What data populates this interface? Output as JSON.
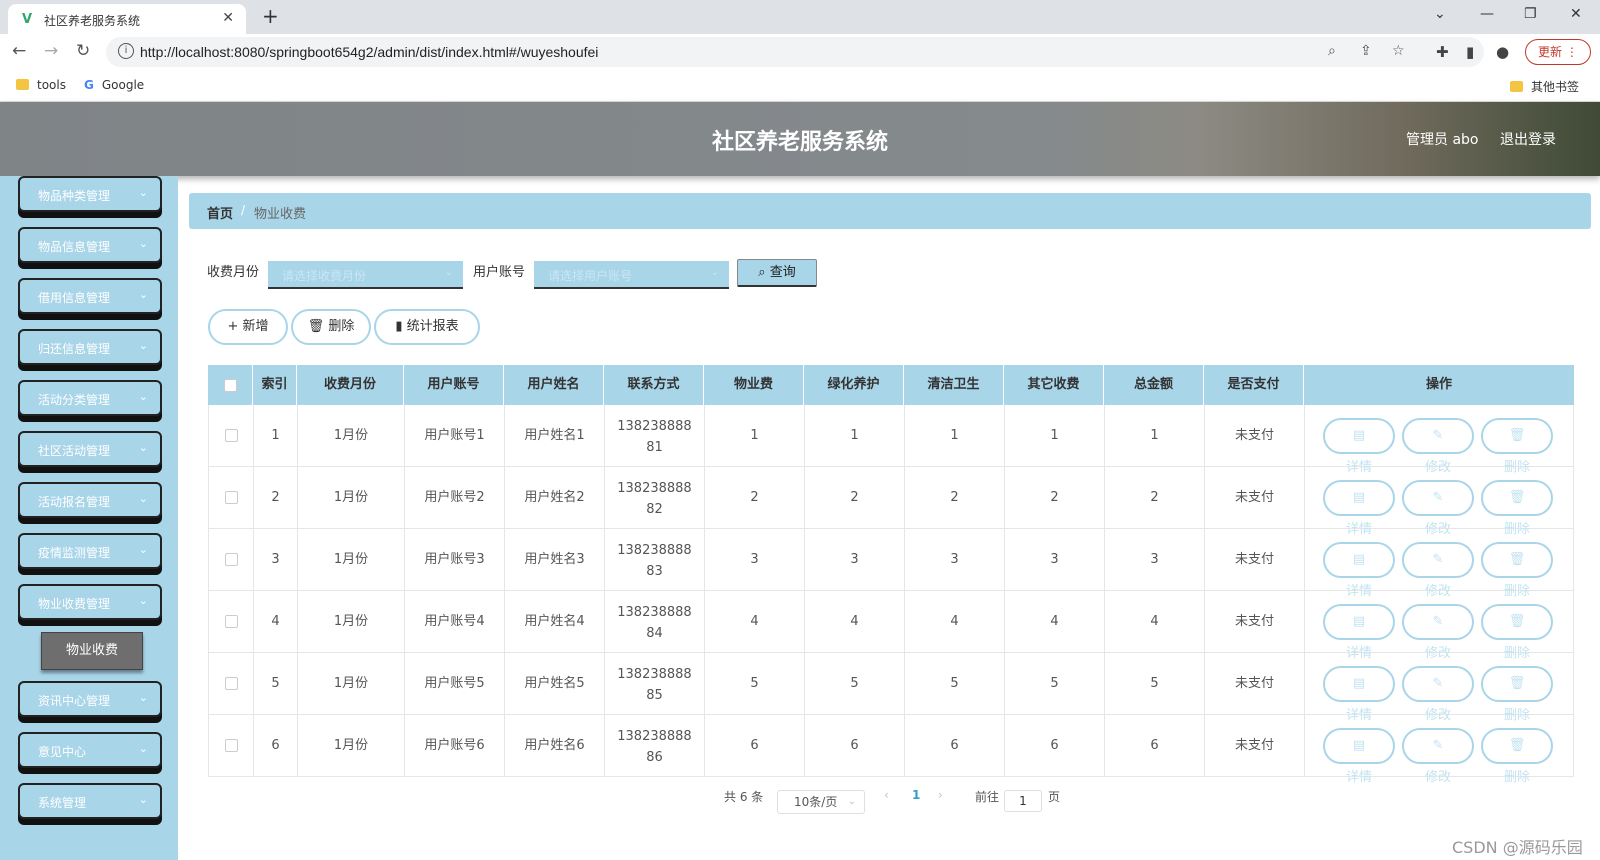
{
  "browser": {
    "tab_title": "社区养老服务系统",
    "url": "http://localhost:8080/springboot654g2/admin/dist/index.html#/wuyeshoufei",
    "update_label": "更新",
    "bookmarks": [
      "tools",
      "Google"
    ],
    "other_bookmarks": "其他书签"
  },
  "header": {
    "title": "社区养老服务系统",
    "admin": "管理员 abo",
    "logout": "退出登录"
  },
  "sidebar": {
    "items": [
      {
        "label": "物品种类管理"
      },
      {
        "label": "物品信息管理"
      },
      {
        "label": "借用信息管理"
      },
      {
        "label": "归还信息管理"
      },
      {
        "label": "活动分类管理"
      },
      {
        "label": "社区活动管理"
      },
      {
        "label": "活动报名管理"
      },
      {
        "label": "疫情监测管理"
      },
      {
        "label": "物业收费管理"
      },
      {
        "label": "资讯中心管理"
      },
      {
        "label": "意见中心"
      },
      {
        "label": "系统管理"
      }
    ],
    "active_sub": "物业收费"
  },
  "breadcrumb": {
    "home": "首页",
    "separator": "/",
    "current": "物业收费"
  },
  "search": {
    "month_label": "收费月份",
    "month_placeholder": "请选择收费月份",
    "account_label": "用户账号",
    "account_placeholder": "请选择用户账号",
    "query_label": "查询"
  },
  "toolbar": {
    "add_label": "新增",
    "delete_label": "删除",
    "report_label": "统计报表"
  },
  "table": {
    "columns": [
      "索引",
      "收费月份",
      "用户账号",
      "用户姓名",
      "联系方式",
      "物业费",
      "绿化养护",
      "清洁卫生",
      "其它收费",
      "总金额",
      "是否支付",
      "操作"
    ],
    "rows": [
      [
        "1",
        "1月份",
        "用户账号1",
        "用户姓名1",
        "13823888881",
        "1",
        "1",
        "1",
        "1",
        "1",
        "未支付"
      ],
      [
        "2",
        "1月份",
        "用户账号2",
        "用户姓名2",
        "13823888882",
        "2",
        "2",
        "2",
        "2",
        "2",
        "未支付"
      ],
      [
        "3",
        "1月份",
        "用户账号3",
        "用户姓名3",
        "13823888883",
        "3",
        "3",
        "3",
        "3",
        "3",
        "未支付"
      ],
      [
        "4",
        "1月份",
        "用户账号4",
        "用户姓名4",
        "13823888884",
        "4",
        "4",
        "4",
        "4",
        "4",
        "未支付"
      ],
      [
        "5",
        "1月份",
        "用户账号5",
        "用户姓名5",
        "13823888885",
        "5",
        "5",
        "5",
        "5",
        "5",
        "未支付"
      ],
      [
        "6",
        "1月份",
        "用户账号6",
        "用户姓名6",
        "13823888886",
        "6",
        "6",
        "6",
        "6",
        "6",
        "未支付"
      ]
    ],
    "actions": {
      "detail": "详情",
      "edit": "修改",
      "delete": "删除"
    }
  },
  "pagination": {
    "total": "共 6 条",
    "page_size": "10条/页",
    "current_page": "1",
    "goto_label": "前往",
    "goto_value": "1",
    "page_suffix": "页"
  },
  "watermark": "CSDN @源码乐园",
  "colors": {
    "accent": "#a9d5e9",
    "header": "#858a8d",
    "active_sub": "#6e6e6e"
  }
}
